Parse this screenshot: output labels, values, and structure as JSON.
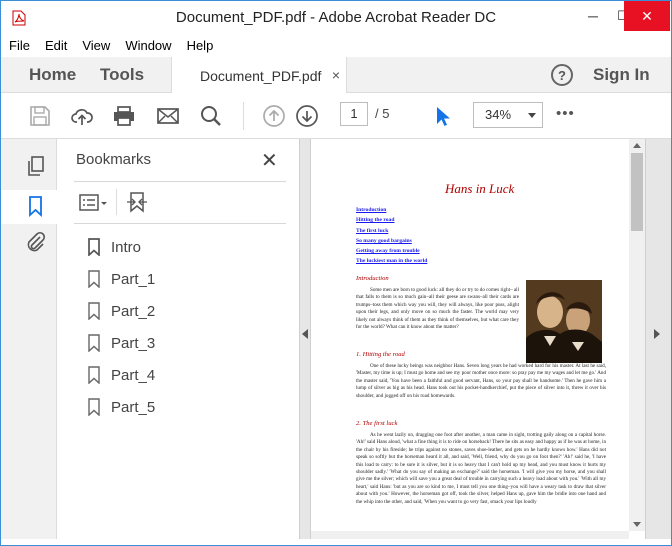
{
  "window": {
    "title": "Document_PDF.pdf - Adobe Acrobat Reader DC",
    "minimize": "─",
    "maximize": "☐",
    "close": "✕"
  },
  "menu": [
    "File",
    "Edit",
    "View",
    "Window",
    "Help"
  ],
  "tabs": {
    "home": "Home",
    "tools": "Tools",
    "document": "Document_PDF.pdf",
    "close": "×",
    "help": "?",
    "sign_in": "Sign In"
  },
  "toolbar": {
    "current_page": "1",
    "page_separator": "/ 5",
    "zoom": "34%",
    "more": "•••"
  },
  "bookmarks": {
    "title": "Bookmarks",
    "close": "✕",
    "items": [
      "Intro",
      "Part_1",
      "Part_2",
      "Part_3",
      "Part_4",
      "Part_5"
    ]
  },
  "document": {
    "title": "Hans in Luck",
    "toc": [
      "Introduction",
      "Hitting the road",
      "The first luck",
      "So many good bargains",
      "Getting away from trouble",
      "The luckiest man in the world"
    ],
    "sections": [
      {
        "heading": "Introduction",
        "text": "Some men are born to good luck: all they do or try to do comes right– all that falls to them is so much gain–all their geese are swans–all their cards are trumps–toss them which way you will, they will always, like poor puss, alight upon their legs, and only move on so much the faster. The world may very likely not always think of them as they think of themselves, but what care they for the world? What can it know about the matter?"
      },
      {
        "heading": "1. Hitting the road",
        "text": "One of these lucky beings was neighbor Hans. Seven long years he had worked hard for his master. At last he said, 'Master, my time is up; I must go home and see my poor mother once more: so pray pay me my wages and let me go.' And the master said, 'You have been a faithful and good servant, Hans, so your pay shall be handsome.' Then he gave him a lump of silver as big as his head. Hans took out his pocket-handkerchief, put the piece of silver into it, threw it over his shoulder, and jogged off on his road homewards."
      },
      {
        "heading": "2. The first luck",
        "text": "As he went lazily on, dragging one foot after another, a man came in sight, trotting gaily along on a capital horse. 'Ah!' said Hans aloud, 'what a fine thing it is to ride on horseback! There he sits as easy and happy as if he was at home, in the chair by his fireside; he trips against no stones, saves shoe-leather, and gets on he hardly knows how.' Hans did not speak so softly but the horseman heard it all, and said, 'Well, friend, why do you go on foot then?' 'Ah!' said he, 'I have this load to carry: to be sure it is silver, but it is so heavy that I can't hold up my head, and you must know it hurts my shoulder sadly.' 'What do you say of making an exchange?' said the horseman. 'I will give you my horse, and you shall give me the silver; which will save you a great deal of trouble in carrying such a heavy load about with you.' 'With all my heart,' said Hans: 'but as you are so kind to me, I must tell you one thing–you will have a weary task to draw that silver about with you.' However, the horseman got off, took the silver, helped Hans up, gave him the bridle into one hand and the whip into the other, and said, 'When you want to go very fast, smack your lips loudly"
      }
    ]
  }
}
